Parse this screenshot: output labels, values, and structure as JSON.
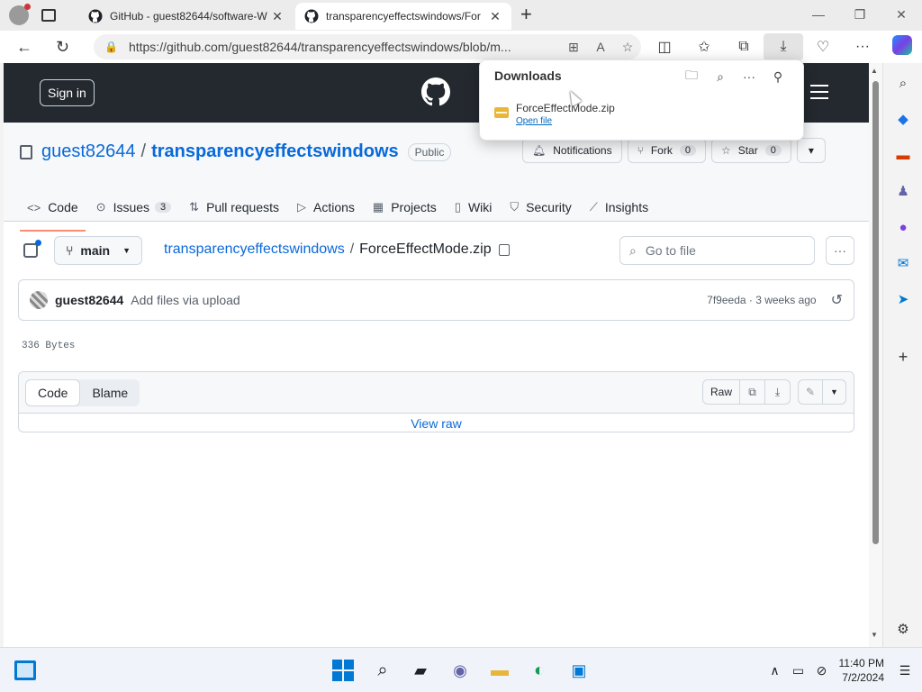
{
  "browser": {
    "tabs": [
      {
        "title": "GitHub - guest82644/software-W",
        "active": false
      },
      {
        "title": "transparencyeffectswindows/For",
        "active": true
      }
    ],
    "new_tab": "+",
    "url": "https://github.com/guest82644/transparencyeffectswindows/blob/m..."
  },
  "downloads": {
    "title": "Downloads",
    "file_name": "ForceEffectMode.zip",
    "open_file": "Open file"
  },
  "header": {
    "sign_in": "Sign in"
  },
  "repo": {
    "owner": "guest82644",
    "separator": "/",
    "name": "transparencyeffectswindows",
    "visibility": "Public",
    "notifications": "Notifications",
    "fork_label": "Fork",
    "fork_count": "0",
    "star_label": "Star",
    "star_count": "0",
    "tabs": [
      {
        "label": "Code",
        "icon": "code-icon"
      },
      {
        "label": "Issues",
        "icon": "issue-icon",
        "count": "3"
      },
      {
        "label": "Pull requests",
        "icon": "pull-request-icon"
      },
      {
        "label": "Actions",
        "icon": "play-icon"
      },
      {
        "label": "Projects",
        "icon": "table-icon"
      },
      {
        "label": "Wiki",
        "icon": "book-icon"
      },
      {
        "label": "Security",
        "icon": "shield-icon"
      },
      {
        "label": "Insights",
        "icon": "graph-icon"
      }
    ]
  },
  "file": {
    "branch": "main",
    "repo_link": "transparencyeffectswindows",
    "separator": "/",
    "name": "ForceEffectMode.zip",
    "go_to_file": "Go to file",
    "size": "336 Bytes"
  },
  "commit": {
    "author": "guest82644",
    "message": "Add files via upload",
    "meta": "7f9eeda · 3 weeks ago"
  },
  "viewer": {
    "code_tab": "Code",
    "blame_tab": "Blame",
    "raw": "Raw",
    "view_raw": "View raw"
  },
  "taskbar": {
    "time": "11:40 PM",
    "date": "7/2/2024"
  },
  "colors": {
    "github_header": "#24292f",
    "link": "#0969da",
    "tab_underline": "#fd8c73",
    "windows_accent": "#0078d4"
  }
}
